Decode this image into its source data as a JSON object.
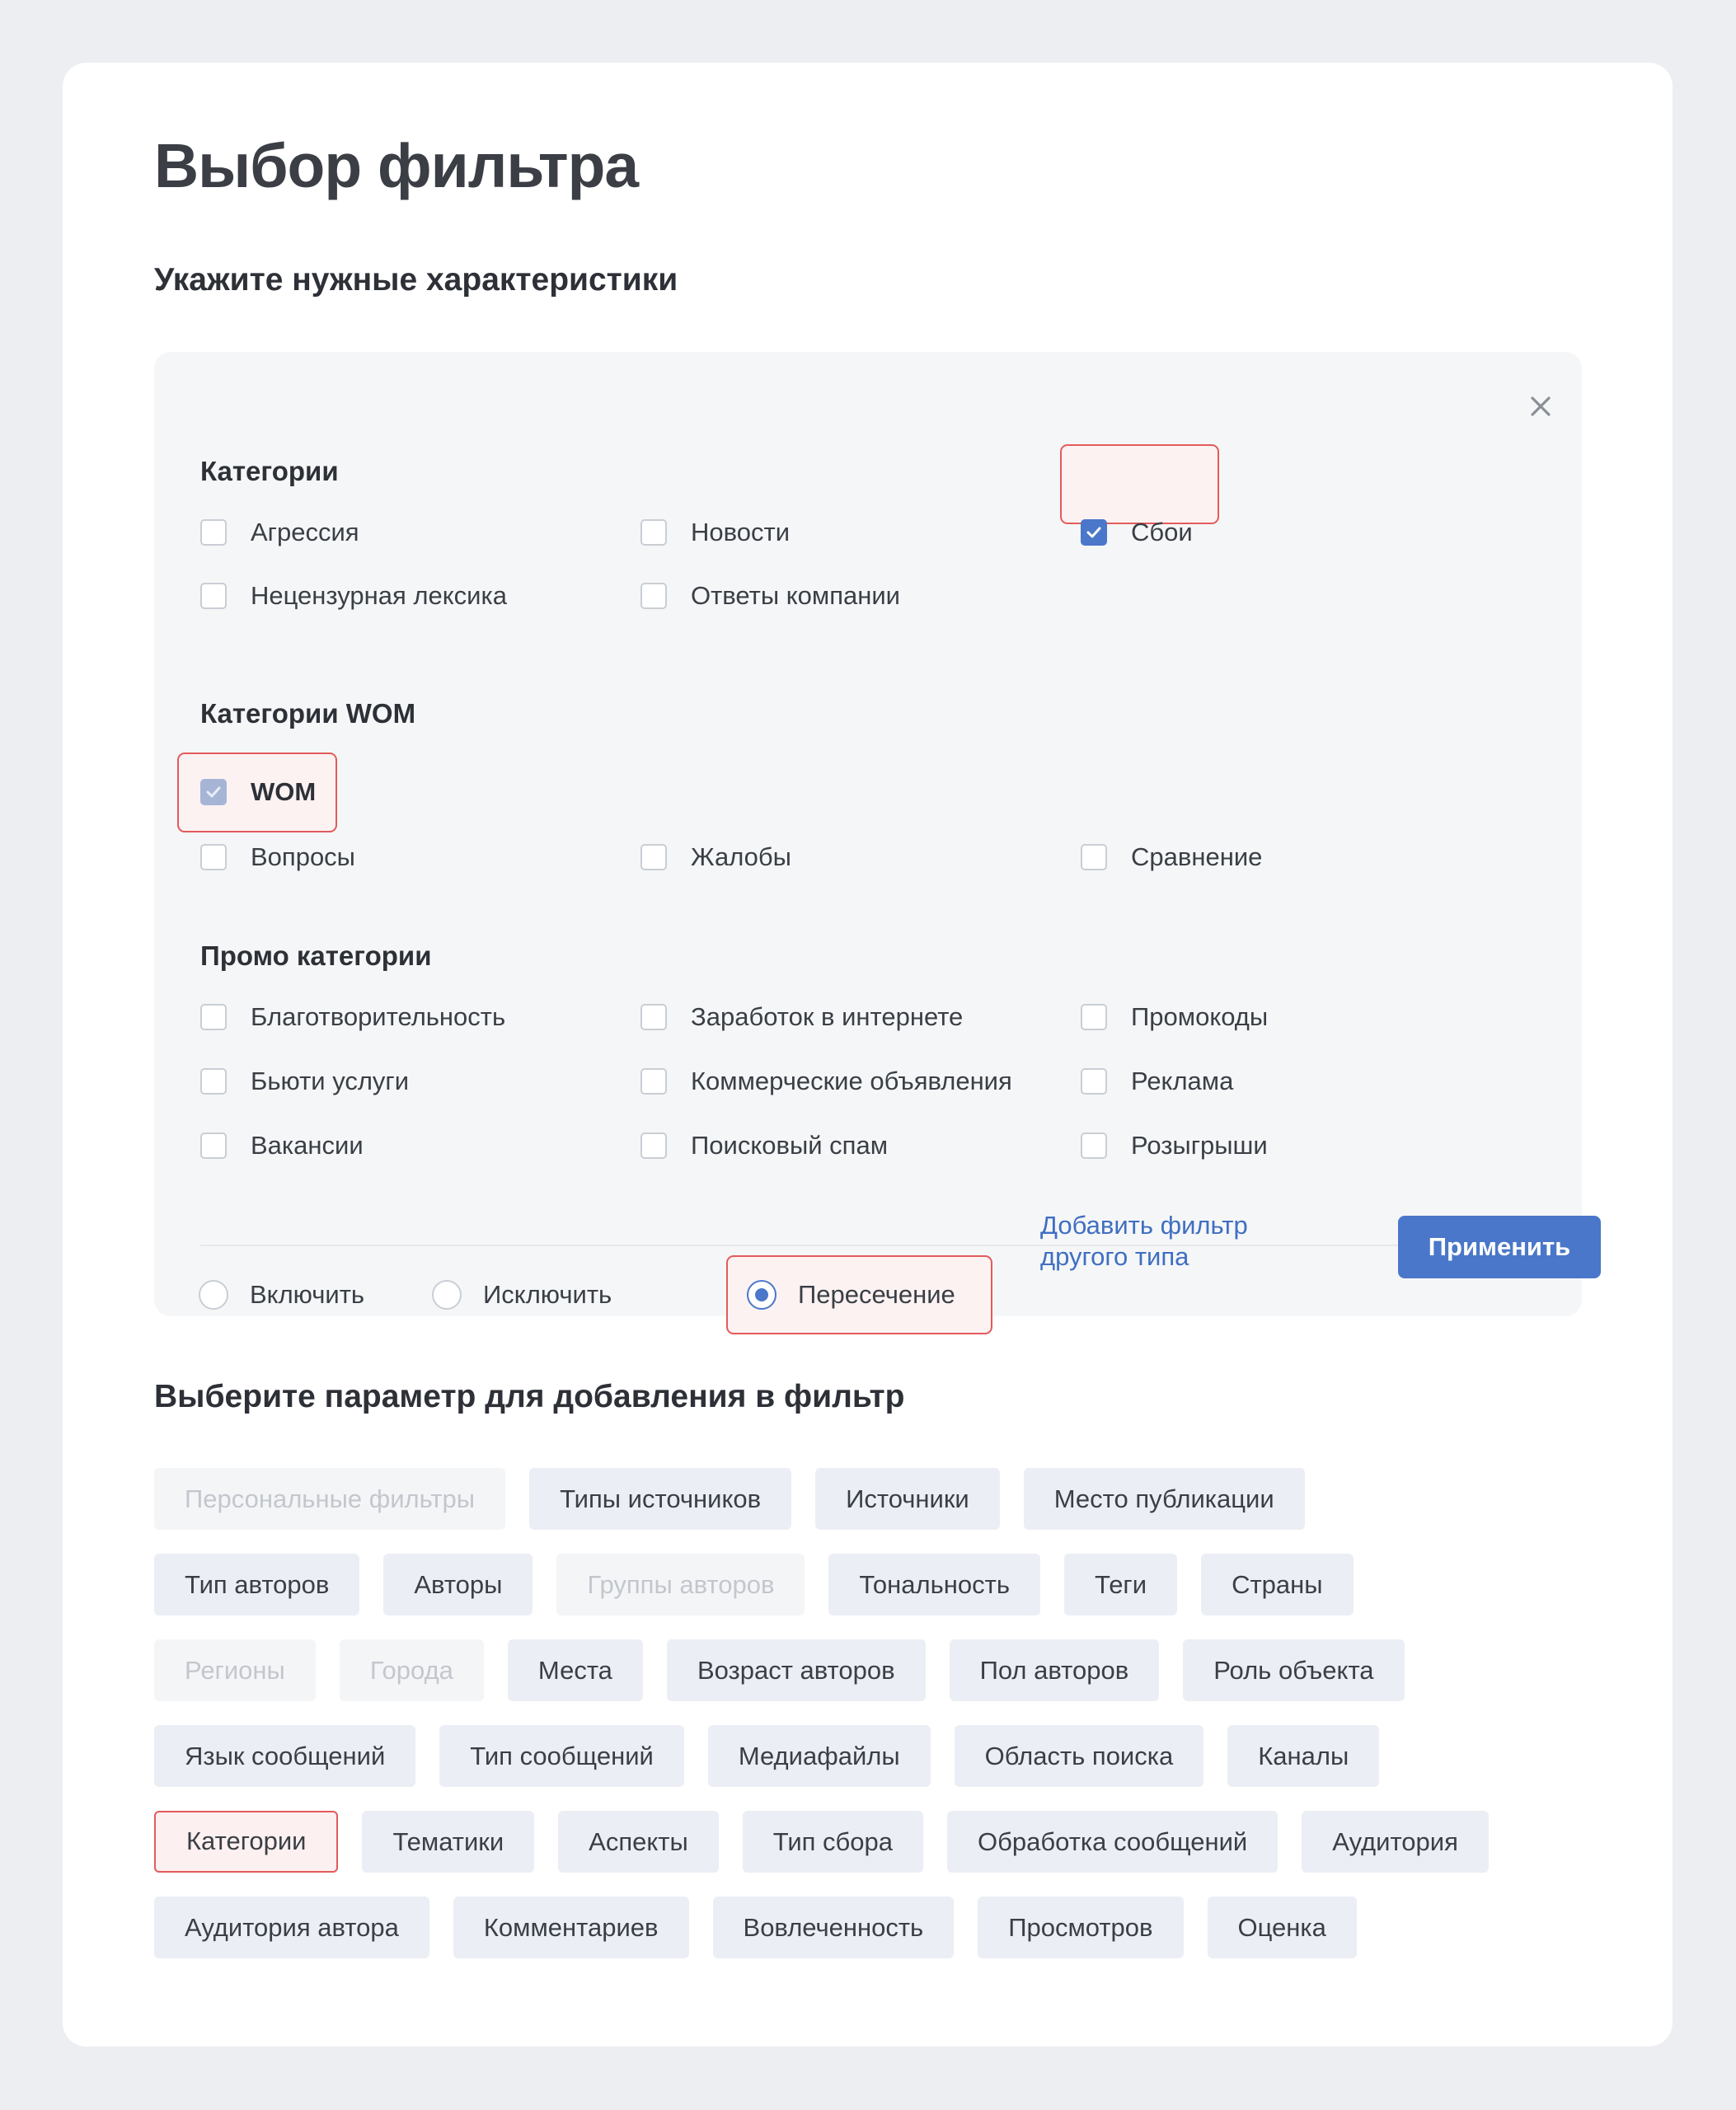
{
  "title": "Выбор фильтра",
  "subtitle": "Укажите нужные характеристики",
  "panel": {
    "sections": [
      {
        "title": "Категории",
        "items": [
          {
            "label": "Агрессия",
            "checked": false
          },
          {
            "label": "Новости",
            "checked": false
          },
          {
            "label": "Сбои",
            "checked": true
          },
          {
            "label": "Нецензурная лексика",
            "checked": false
          },
          {
            "label": "Ответы компании",
            "checked": false
          }
        ]
      },
      {
        "title": "Категории WOM",
        "items": [
          {
            "label": "WOM",
            "checked": true
          },
          {
            "label": "Вопросы",
            "checked": false
          },
          {
            "label": "Жалобы",
            "checked": false
          },
          {
            "label": "Сравнение",
            "checked": false
          }
        ]
      },
      {
        "title": "Промо категории",
        "items": [
          {
            "label": "Благотворительность",
            "checked": false
          },
          {
            "label": "Заработок в интернете",
            "checked": false
          },
          {
            "label": "Промокоды",
            "checked": false
          },
          {
            "label": "Бьюти услуги",
            "checked": false
          },
          {
            "label": "Коммерческие объявления",
            "checked": false
          },
          {
            "label": "Реклама",
            "checked": false
          },
          {
            "label": "Вакансии",
            "checked": false
          },
          {
            "label": "Поисковый спам",
            "checked": false
          },
          {
            "label": "Розыгрыши",
            "checked": false
          }
        ]
      }
    ],
    "modes": [
      {
        "label": "Включить",
        "selected": false
      },
      {
        "label": "Исключить",
        "selected": false
      },
      {
        "label": "Пересечение",
        "selected": true
      }
    ],
    "add_filter_link": "Добавить фильтр другого типа",
    "apply_label": "Применить"
  },
  "params_title": "Выберите параметр для добавления в фильтр",
  "param_rows": [
    [
      {
        "label": "Персональные фильтры",
        "state": "disabled"
      },
      {
        "label": "Типы источников",
        "state": "normal"
      },
      {
        "label": "Источники",
        "state": "normal"
      },
      {
        "label": "Место публикации",
        "state": "normal"
      }
    ],
    [
      {
        "label": "Тип авторов",
        "state": "normal"
      },
      {
        "label": "Авторы",
        "state": "normal"
      },
      {
        "label": "Группы авторов",
        "state": "disabled"
      },
      {
        "label": "Тональность",
        "state": "normal"
      },
      {
        "label": "Теги",
        "state": "normal"
      },
      {
        "label": "Страны",
        "state": "normal"
      }
    ],
    [
      {
        "label": "Регионы",
        "state": "disabled"
      },
      {
        "label": "Города",
        "state": "disabled"
      },
      {
        "label": "Места",
        "state": "normal"
      },
      {
        "label": "Возраст авторов",
        "state": "normal"
      },
      {
        "label": "Пол авторов",
        "state": "normal"
      },
      {
        "label": "Роль объекта",
        "state": "normal"
      }
    ],
    [
      {
        "label": "Язык сообщений",
        "state": "normal"
      },
      {
        "label": "Тип сообщений",
        "state": "normal"
      },
      {
        "label": "Медиафайлы",
        "state": "normal"
      },
      {
        "label": "Область поиска",
        "state": "normal"
      },
      {
        "label": "Каналы",
        "state": "normal"
      }
    ],
    [
      {
        "label": "Категории",
        "state": "selected"
      },
      {
        "label": "Тематики",
        "state": "normal"
      },
      {
        "label": "Аспекты",
        "state": "normal"
      },
      {
        "label": "Тип сбора",
        "state": "normal"
      },
      {
        "label": "Обработка сообщений",
        "state": "normal"
      },
      {
        "label": "Аудитория",
        "state": "normal"
      }
    ],
    [
      {
        "label": "Аудитория автора",
        "state": "normal"
      },
      {
        "label": "Комментариев",
        "state": "normal"
      },
      {
        "label": "Вовлеченность",
        "state": "normal"
      },
      {
        "label": "Просмотров",
        "state": "normal"
      },
      {
        "label": "Оценка",
        "state": "normal"
      }
    ]
  ],
  "colors": {
    "accent": "#4a77c9",
    "highlight_border": "#e35b5b"
  }
}
